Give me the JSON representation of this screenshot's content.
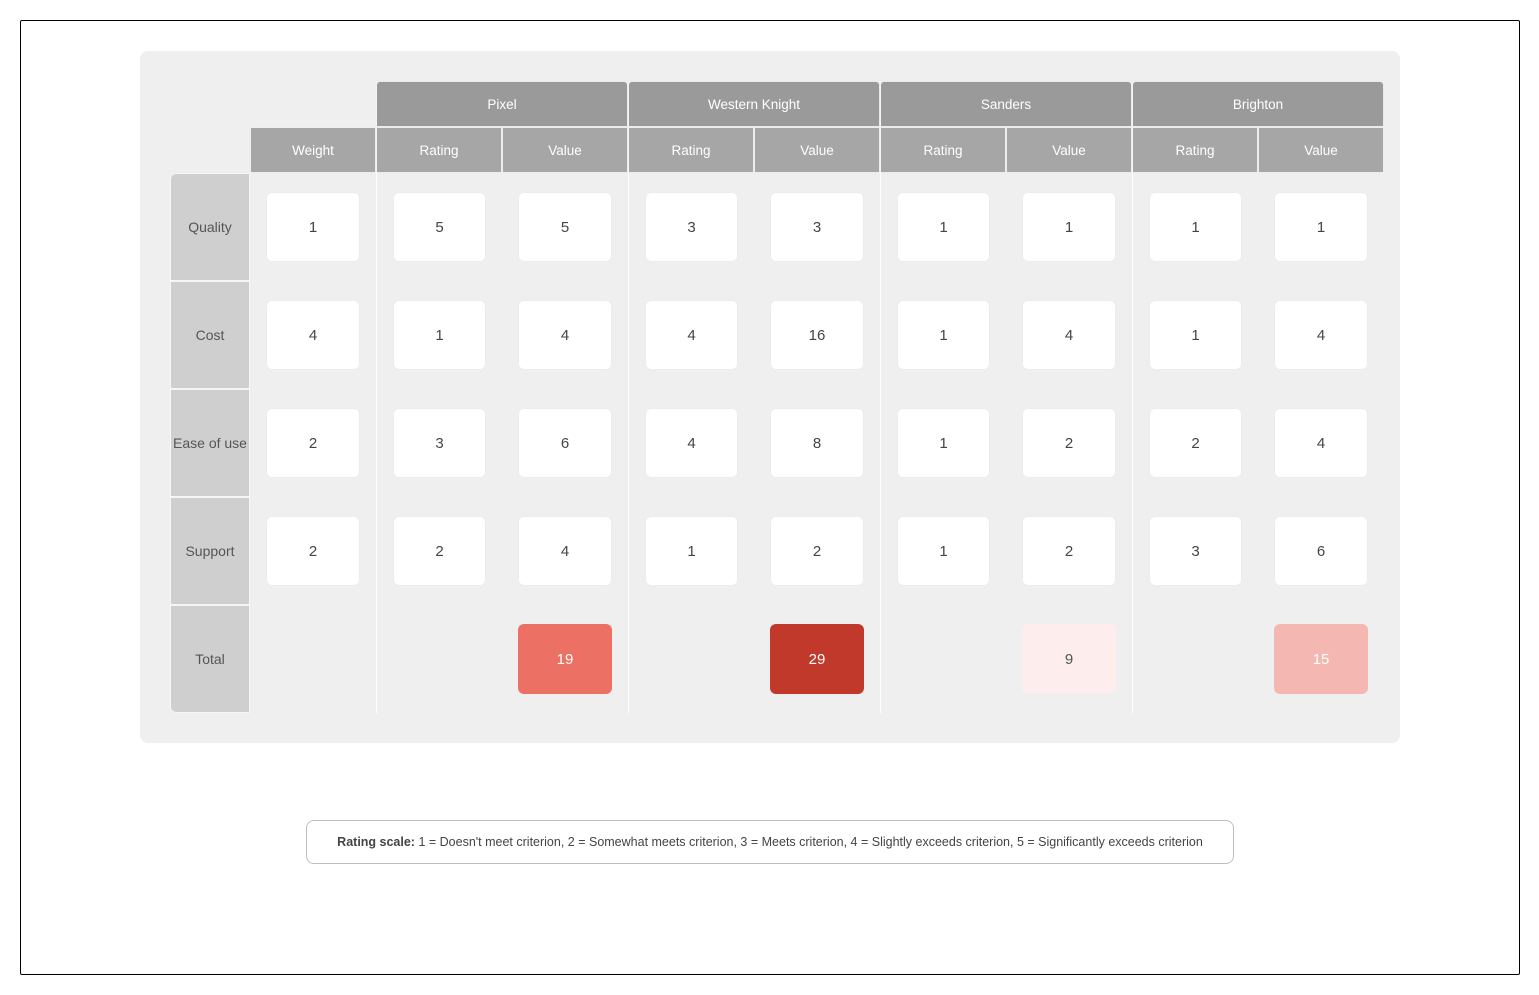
{
  "headers": {
    "weight": "Weight",
    "rating": "Rating",
    "value": "Value"
  },
  "vendors": [
    "Pixel",
    "Western Knight",
    "Sanders",
    "Brighton"
  ],
  "criteria": [
    {
      "name": "Quality",
      "weight": "1",
      "cells": [
        [
          "5",
          "5"
        ],
        [
          "3",
          "3"
        ],
        [
          "1",
          "1"
        ],
        [
          "1",
          "1"
        ]
      ]
    },
    {
      "name": "Cost",
      "weight": "4",
      "cells": [
        [
          "1",
          "4"
        ],
        [
          "4",
          "16"
        ],
        [
          "1",
          "4"
        ],
        [
          "1",
          "4"
        ]
      ]
    },
    {
      "name": "Ease of use",
      "weight": "2",
      "cells": [
        [
          "3",
          "6"
        ],
        [
          "4",
          "8"
        ],
        [
          "1",
          "2"
        ],
        [
          "2",
          "4"
        ]
      ]
    },
    {
      "name": "Support",
      "weight": "2",
      "cells": [
        [
          "2",
          "4"
        ],
        [
          "1",
          "2"
        ],
        [
          "1",
          "2"
        ],
        [
          "3",
          "6"
        ]
      ]
    }
  ],
  "totals_label": "Total",
  "totals": [
    {
      "value": "19",
      "bg": "#ec7063"
    },
    {
      "value": "29",
      "bg": "#c0392b"
    },
    {
      "value": "9",
      "bg": "#fdedec"
    },
    {
      "value": "15",
      "bg": "#f5b7b1"
    }
  ],
  "legend": {
    "label": "Rating scale:",
    "text": " 1 = Doesn't meet criterion, 2 = Somewhat meets criterion, 3 = Meets criterion, 4 = Slightly exceeds criterion, 5 = Significantly exceeds criterion"
  }
}
